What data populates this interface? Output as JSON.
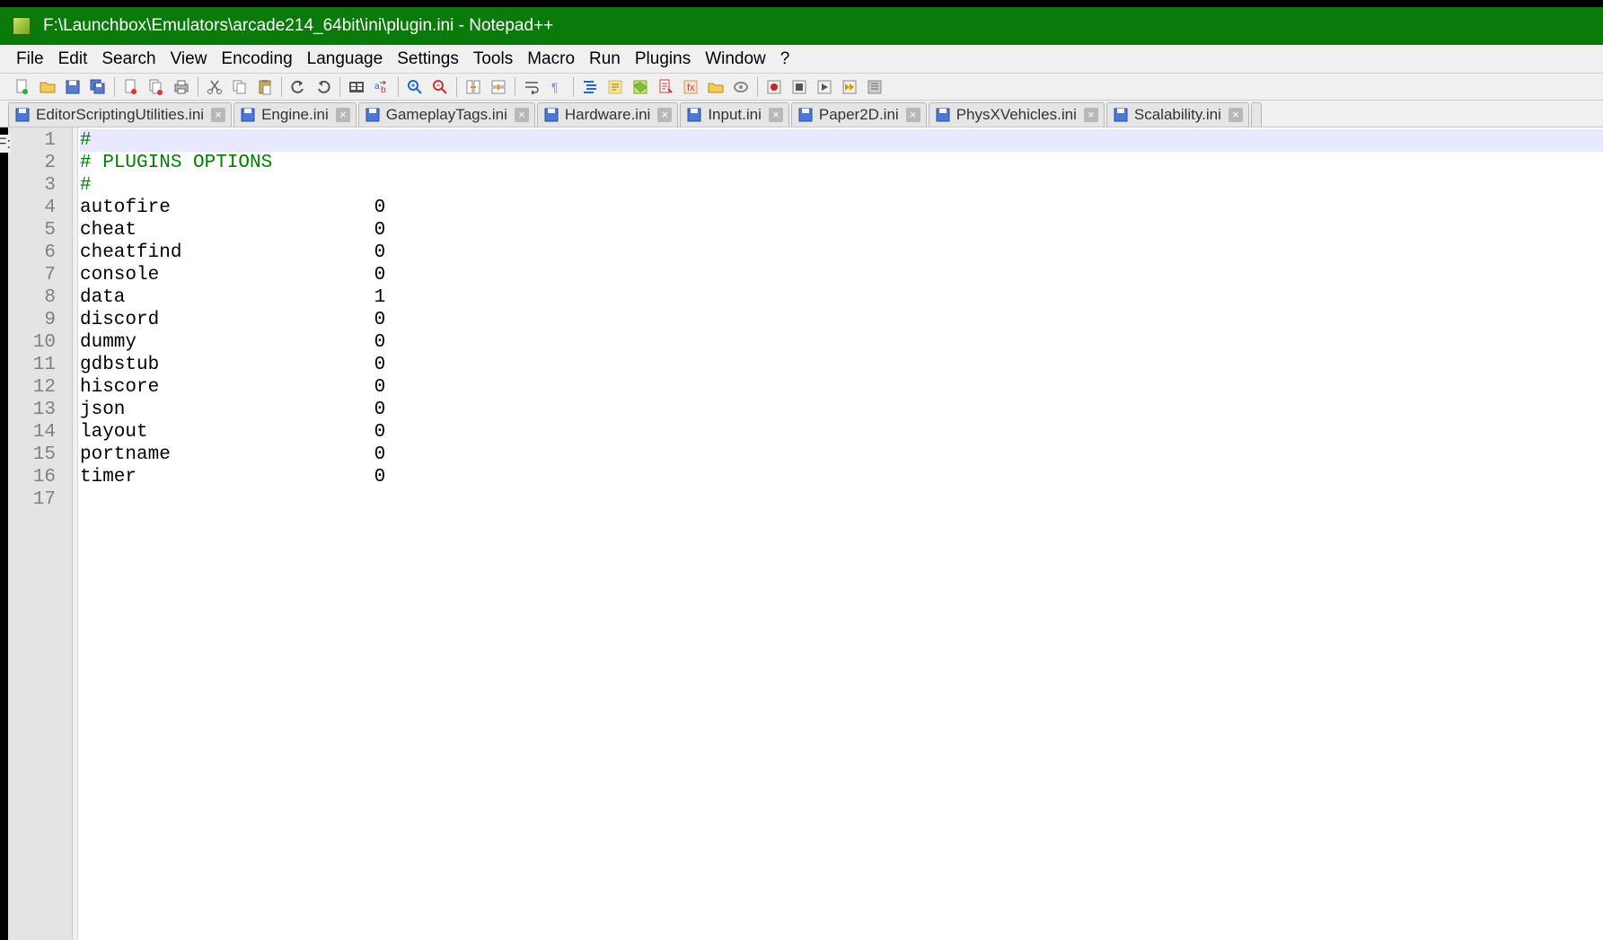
{
  "title": "F:\\Launchbox\\Emulators\\arcade214_64bit\\ini\\plugin.ini - Notepad++",
  "menu": [
    "File",
    "Edit",
    "Search",
    "View",
    "Encoding",
    "Language",
    "Settings",
    "Tools",
    "Macro",
    "Run",
    "Plugins",
    "Window",
    "?"
  ],
  "tabs": [
    {
      "label": "EditorScriptingUtilities.ini",
      "active": false
    },
    {
      "label": "Engine.ini",
      "active": false
    },
    {
      "label": "GameplayTags.ini",
      "active": false
    },
    {
      "label": "Hardware.ini",
      "active": false
    },
    {
      "label": "Input.ini",
      "active": false
    },
    {
      "label": "Paper2D.ini",
      "active": false
    },
    {
      "label": "PhysXVehicles.ini",
      "active": false
    },
    {
      "label": "Scalability.ini",
      "active": false
    }
  ],
  "lines": [
    {
      "type": "comment",
      "text": "#"
    },
    {
      "type": "comment",
      "text": "# PLUGINS OPTIONS"
    },
    {
      "type": "comment",
      "text": "#"
    },
    {
      "type": "kv",
      "key": "autofire",
      "value": "0"
    },
    {
      "type": "kv",
      "key": "cheat",
      "value": "0"
    },
    {
      "type": "kv",
      "key": "cheatfind",
      "value": "0"
    },
    {
      "type": "kv",
      "key": "console",
      "value": "0"
    },
    {
      "type": "kv",
      "key": "data",
      "value": "1"
    },
    {
      "type": "kv",
      "key": "discord",
      "value": "0"
    },
    {
      "type": "kv",
      "key": "dummy",
      "value": "0"
    },
    {
      "type": "kv",
      "key": "gdbstub",
      "value": "0"
    },
    {
      "type": "kv",
      "key": "hiscore",
      "value": "0"
    },
    {
      "type": "kv",
      "key": "json",
      "value": "0"
    },
    {
      "type": "kv",
      "key": "layout",
      "value": "0"
    },
    {
      "type": "kv",
      "key": "portname",
      "value": "0"
    },
    {
      "type": "kv",
      "key": "timer",
      "value": "0"
    },
    {
      "type": "blank",
      "text": ""
    }
  ],
  "side_label": "F:"
}
